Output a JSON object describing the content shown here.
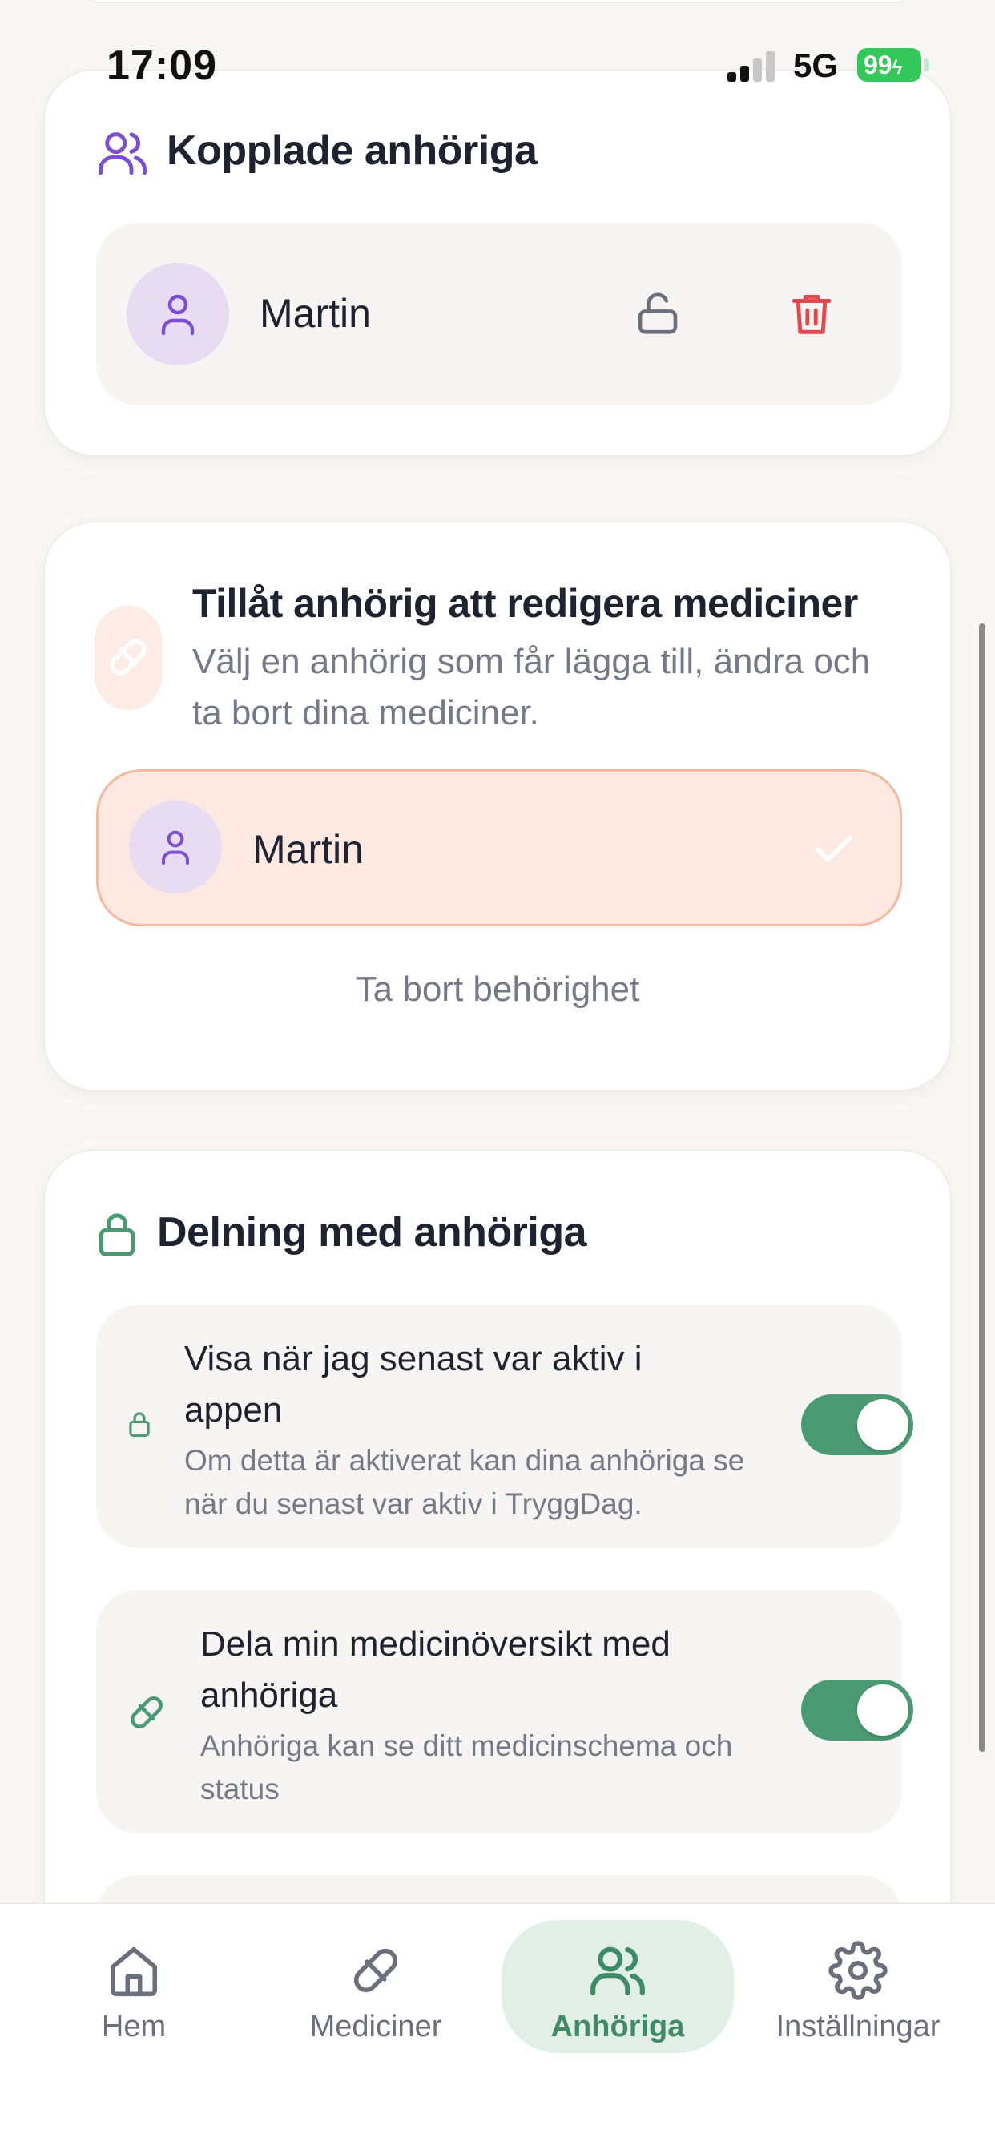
{
  "status_bar": {
    "time": "17:09",
    "network": "5G",
    "battery": "99"
  },
  "connected": {
    "title": "Kopplade anhöriga",
    "relatives": [
      {
        "name": "Martin"
      }
    ]
  },
  "edit_permission": {
    "title": "Tillåt anhörig att redigera mediciner",
    "description": "Välj en anhörig som får lägga till, ändra och ta bort dina mediciner.",
    "selected_relative": "Martin",
    "remove_label": "Ta bort behörighet"
  },
  "sharing": {
    "title": "Delning med anhöriga",
    "settings": [
      {
        "title": "Visa när jag senast var aktiv i appen",
        "description": "Om detta är aktiverat kan dina anhöriga se när du senast var aktiv i TryggDag.",
        "enabled": true
      },
      {
        "title": "Dela min medicinöversikt med anhöriga",
        "description": "Anhöriga kan se ditt medicinschema och status",
        "enabled": true
      }
    ]
  },
  "bottom_nav": {
    "items": [
      {
        "label": "Hem",
        "icon": "home-icon"
      },
      {
        "label": "Mediciner",
        "icon": "pill-icon"
      },
      {
        "label": "Anhöriga",
        "icon": "users-icon"
      },
      {
        "label": "Inställningar",
        "icon": "gear-icon"
      }
    ],
    "active": "Anhöriga"
  },
  "colors": {
    "accent_green": "#4a9a73",
    "accent_purple": "#7b4fd1",
    "danger_red": "#e5484d",
    "selected_bg": "#fde9e2",
    "selected_border": "#f5b99f"
  }
}
